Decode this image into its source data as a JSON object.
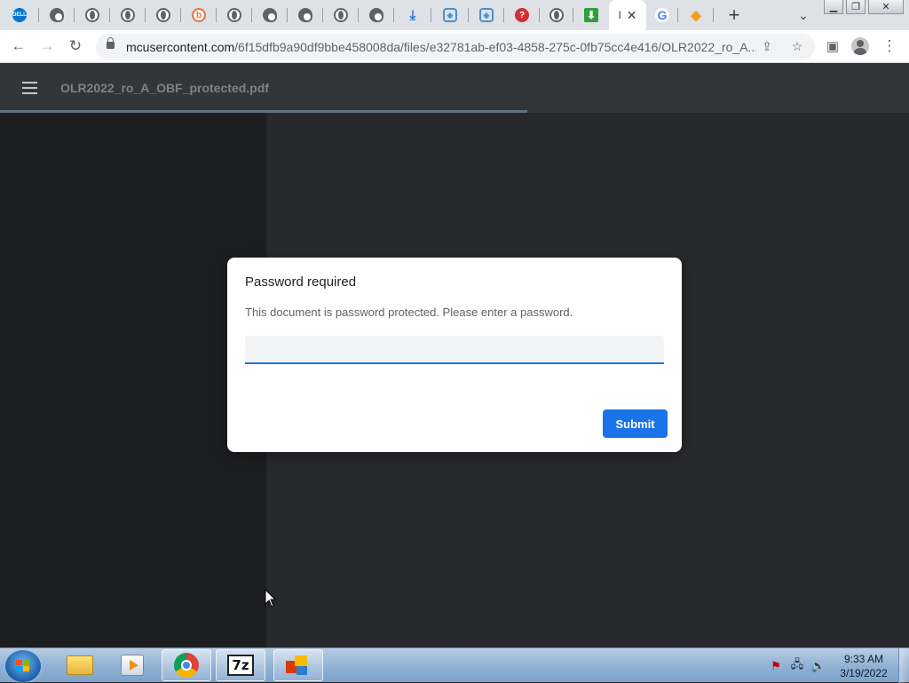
{
  "browser": {
    "tabs": [
      {
        "icon": "dell-icon"
      },
      {
        "icon": "chrome-icon"
      },
      {
        "icon": "globe-icon"
      },
      {
        "icon": "globe-icon"
      },
      {
        "icon": "bing-icon"
      },
      {
        "icon": "globe-icon"
      },
      {
        "icon": "chrome-icon"
      },
      {
        "icon": "chrome-icon"
      },
      {
        "icon": "globe-icon"
      },
      {
        "icon": "chrome-icon"
      },
      {
        "icon": "download-icon"
      },
      {
        "icon": "codesandbox-icon"
      },
      {
        "icon": "codesandbox-icon"
      },
      {
        "icon": "quora-icon"
      },
      {
        "icon": "globe-icon"
      },
      {
        "icon": "download-green-icon"
      },
      {
        "icon": "active-tab",
        "title": "I"
      },
      {
        "icon": "google-icon"
      },
      {
        "icon": "diamond-icon"
      }
    ],
    "new_tab_label": "+",
    "url_host": "mcusercontent.com",
    "url_path": "/6f15dfb9a90df9bbe458008da/files/e32781ab-ef03-4858-275c-0fb75cc4e416/OLR2022_ro_A..."
  },
  "pdf_viewer": {
    "file_name": "OLR2022_ro_A_OBF_protected.pdf",
    "load_progress": 0.58
  },
  "dialog": {
    "title": "Password required",
    "message": "This document is password protected. Please enter a password.",
    "password_value": "",
    "submit_label": "Submit"
  },
  "taskbar": {
    "apps": [
      "windows-explorer",
      "windows-media-player",
      "google-chrome",
      "7-zip",
      "microsoft-office"
    ],
    "time": "9:33 AM",
    "date": "3/19/2022"
  },
  "colors": {
    "accent": "#1a73e8",
    "viewer_toolbar": "#323639",
    "viewer_background": "#28292c",
    "sidebar_background": "#1d1e20"
  }
}
